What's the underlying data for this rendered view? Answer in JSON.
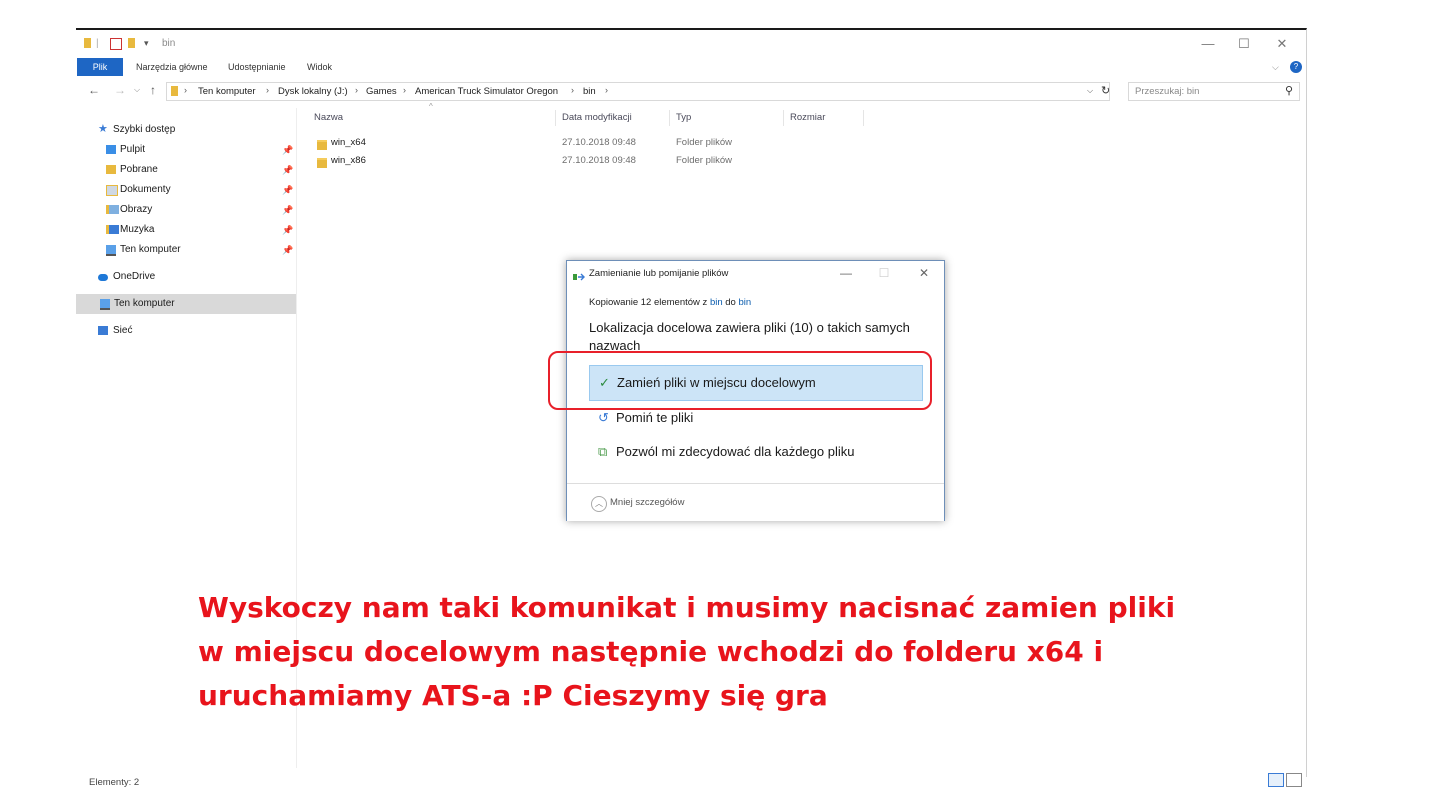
{
  "window": {
    "title": "bin",
    "controls": {
      "minimize": "—",
      "maximize": "☐",
      "close": "✕"
    }
  },
  "ribbon": {
    "tabs": [
      "Plik",
      "Narzędzia główne",
      "Udostępnianie",
      "Widok"
    ]
  },
  "address": {
    "crumbs": [
      "Ten komputer",
      "Dysk lokalny (J:)",
      "Games",
      "American Truck Simulator Oregon",
      "bin"
    ],
    "search_placeholder": "Przeszukaj: bin"
  },
  "sidebar": {
    "quick_access": "Szybki dostęp",
    "pinned": [
      "Pulpit",
      "Pobrane",
      "Dokumenty",
      "Obrazy",
      "Muzyka",
      "Ten komputer"
    ],
    "onedrive": "OneDrive",
    "this_pc": "Ten komputer",
    "network": "Sieć"
  },
  "columns": {
    "name": "Nazwa",
    "date": "Data modyfikacji",
    "type": "Typ",
    "size": "Rozmiar"
  },
  "files": [
    {
      "name": "win_x64",
      "date": "27.10.2018 09:48",
      "type": "Folder plików"
    },
    {
      "name": "win_x86",
      "date": "27.10.2018 09:48",
      "type": "Folder plików"
    }
  ],
  "status": {
    "count": "Elementy: 2"
  },
  "dialog": {
    "title": "Zamienianie lub pomijanie plików",
    "copy_prefix": "Kopiowanie 12 elementów z ",
    "src": "bin",
    "mid": " do ",
    "dst": "bin",
    "message": "Lokalizacja docelowa zawiera pliki (10) o takich samych nazwach",
    "options": [
      {
        "icon": "✓",
        "label": "Zamień pliki w miejscu docelowym"
      },
      {
        "icon": "↺",
        "label": "Pomiń te pliki"
      },
      {
        "icon": "⧉",
        "label": "Pozwól mi zdecydować dla każdego pliku"
      }
    ],
    "less_details": "Mniej szczegółów"
  },
  "annotation": "Wyskoczy nam taki komunikat i musimy nacisnać zamien pliki w miejscu docelowym następnie wchodzi do folderu x64 i uruchamiamy ATS-a :P Cieszymy się gra",
  "colors": {
    "accent": "#1e66c4",
    "highlight": "#cce4f7",
    "annotation": "#e8141c"
  }
}
